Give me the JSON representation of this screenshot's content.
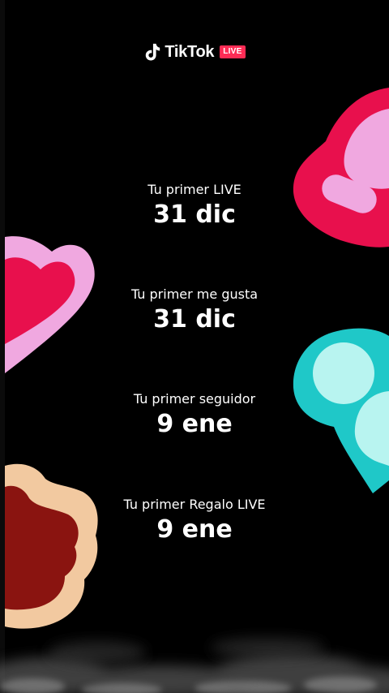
{
  "brand": {
    "name": "TikTok",
    "badge": "LIVE",
    "icon": "tiktok-note-icon",
    "accent_color": "#fe2c55"
  },
  "milestones": [
    {
      "label": "Tu primer LIVE",
      "date": "31 dic"
    },
    {
      "label": "Tu primer me gusta",
      "date": "31 dic"
    },
    {
      "label": "Tu primer seguidor",
      "date": "9 ene"
    },
    {
      "label": "Tu primer Regalo LIVE",
      "date": "9 ene"
    }
  ],
  "stickers": [
    {
      "name": "live-hand-sticker-icon",
      "colors": [
        "#e8104d",
        "#f0a8e0"
      ]
    },
    {
      "name": "heart-sticker-icon",
      "colors": [
        "#e8104d",
        "#f0a8e0"
      ]
    },
    {
      "name": "follower-people-sticker-icon",
      "colors": [
        "#1fc8c8",
        "#b8f4f0"
      ]
    },
    {
      "name": "thumbs-up-sticker-icon",
      "colors": [
        "#8a1410",
        "#f2c9a0"
      ]
    }
  ],
  "background_color": "#000000"
}
